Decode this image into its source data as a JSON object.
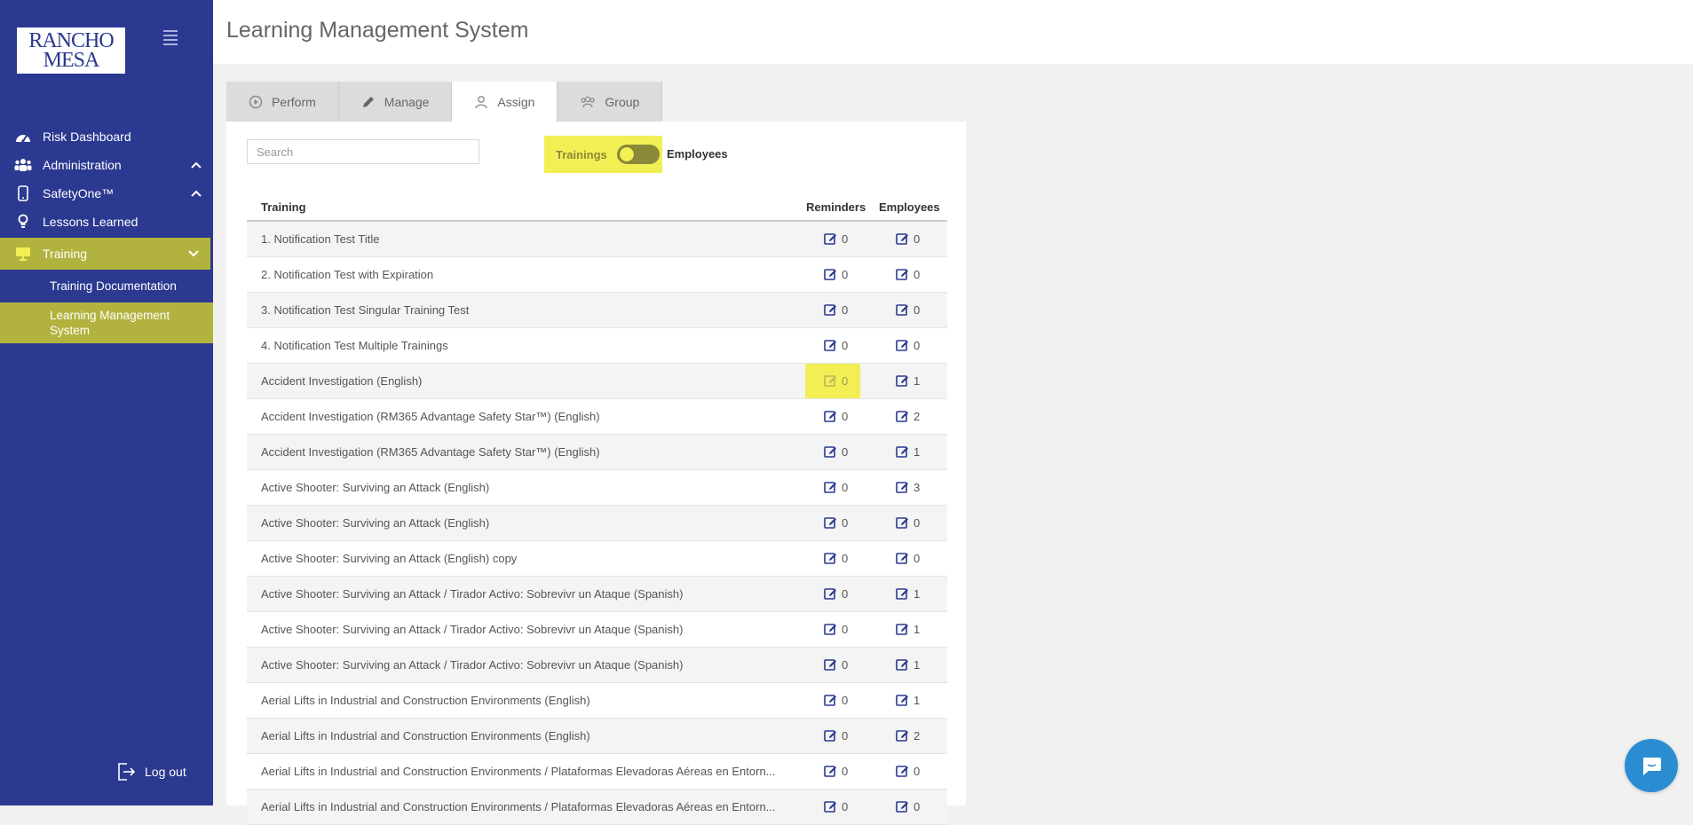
{
  "logo": {
    "line1": "RANCHO",
    "line2": "MESA"
  },
  "sidebar": {
    "items": [
      {
        "label": "Risk Dashboard",
        "icon": "dashboard-icon"
      },
      {
        "label": "Administration",
        "icon": "users-icon",
        "expanded": true
      },
      {
        "label": "SafetyOne™",
        "icon": "mobile-icon",
        "expanded": true
      },
      {
        "label": "Lessons Learned",
        "icon": "lightbulb-icon"
      },
      {
        "label": "Training",
        "icon": "presentation-icon",
        "active": true,
        "expanded": true
      }
    ],
    "sub_items": [
      {
        "label": "Training Documentation"
      },
      {
        "label": "Learning Management System",
        "active": true
      }
    ],
    "logout_label": "Log out"
  },
  "header": {
    "title": "Learning Management System"
  },
  "tabs": [
    {
      "label": "Perform",
      "icon": "play-circle-icon"
    },
    {
      "label": "Manage",
      "icon": "pencil-icon"
    },
    {
      "label": "Assign",
      "icon": "user-icon",
      "active": true
    },
    {
      "label": "Group",
      "icon": "group-icon"
    }
  ],
  "search": {
    "placeholder": "Search"
  },
  "toggle": {
    "left_label": "Trainings",
    "right_label": "Employees",
    "state": "Trainings"
  },
  "table": {
    "headers": {
      "training": "Training",
      "reminders": "Reminders",
      "employees": "Employees"
    },
    "rows": [
      {
        "name": "1. Notification Test Title",
        "reminders": "0",
        "employees": "0"
      },
      {
        "name": "2. Notification Test with Expiration",
        "reminders": "0",
        "employees": "0"
      },
      {
        "name": "3. Notification Test Singular Training Test",
        "reminders": "0",
        "employees": "0"
      },
      {
        "name": "4. Notification Test Multiple Trainings",
        "reminders": "0",
        "employees": "0"
      },
      {
        "name": "Accident Investigation (English)",
        "reminders": "0",
        "employees": "1",
        "highlight": true
      },
      {
        "name": "Accident Investigation (RM365 Advantage Safety Star™) (English)",
        "reminders": "0",
        "employees": "2"
      },
      {
        "name": "Accident Investigation (RM365 Advantage Safety Star™) (English)",
        "reminders": "0",
        "employees": "1"
      },
      {
        "name": "Active Shooter: Surviving an Attack (English)",
        "reminders": "0",
        "employees": "3"
      },
      {
        "name": "Active Shooter: Surviving an Attack (English)",
        "reminders": "0",
        "employees": "0"
      },
      {
        "name": "Active Shooter: Surviving an Attack (English) copy",
        "reminders": "0",
        "employees": "0"
      },
      {
        "name": "Active Shooter: Surviving an Attack / Tirador Activo: Sobrevivr un Ataque (Spanish)",
        "reminders": "0",
        "employees": "1"
      },
      {
        "name": "Active Shooter: Surviving an Attack / Tirador Activo: Sobrevivr un Ataque (Spanish)",
        "reminders": "0",
        "employees": "1"
      },
      {
        "name": "Active Shooter: Surviving an Attack / Tirador Activo: Sobrevivr un Ataque (Spanish)",
        "reminders": "0",
        "employees": "1"
      },
      {
        "name": "Aerial Lifts in Industrial and Construction Environments (English)",
        "reminders": "0",
        "employees": "1"
      },
      {
        "name": "Aerial Lifts in Industrial and Construction Environments (English)",
        "reminders": "0",
        "employees": "2"
      },
      {
        "name": "Aerial Lifts in Industrial and Construction Environments / Plataformas Elevadoras Aéreas en Entorn...",
        "reminders": "0",
        "employees": "0"
      },
      {
        "name": "Aerial Lifts in Industrial and Construction Environments / Plataformas Elevadoras Aéreas en Entorn...",
        "reminders": "0",
        "employees": "0"
      }
    ]
  },
  "colors": {
    "sidebar": "#2b3990",
    "active": "#b2b33f",
    "highlight": "#f2ef55",
    "chat": "#2b8dd1"
  }
}
